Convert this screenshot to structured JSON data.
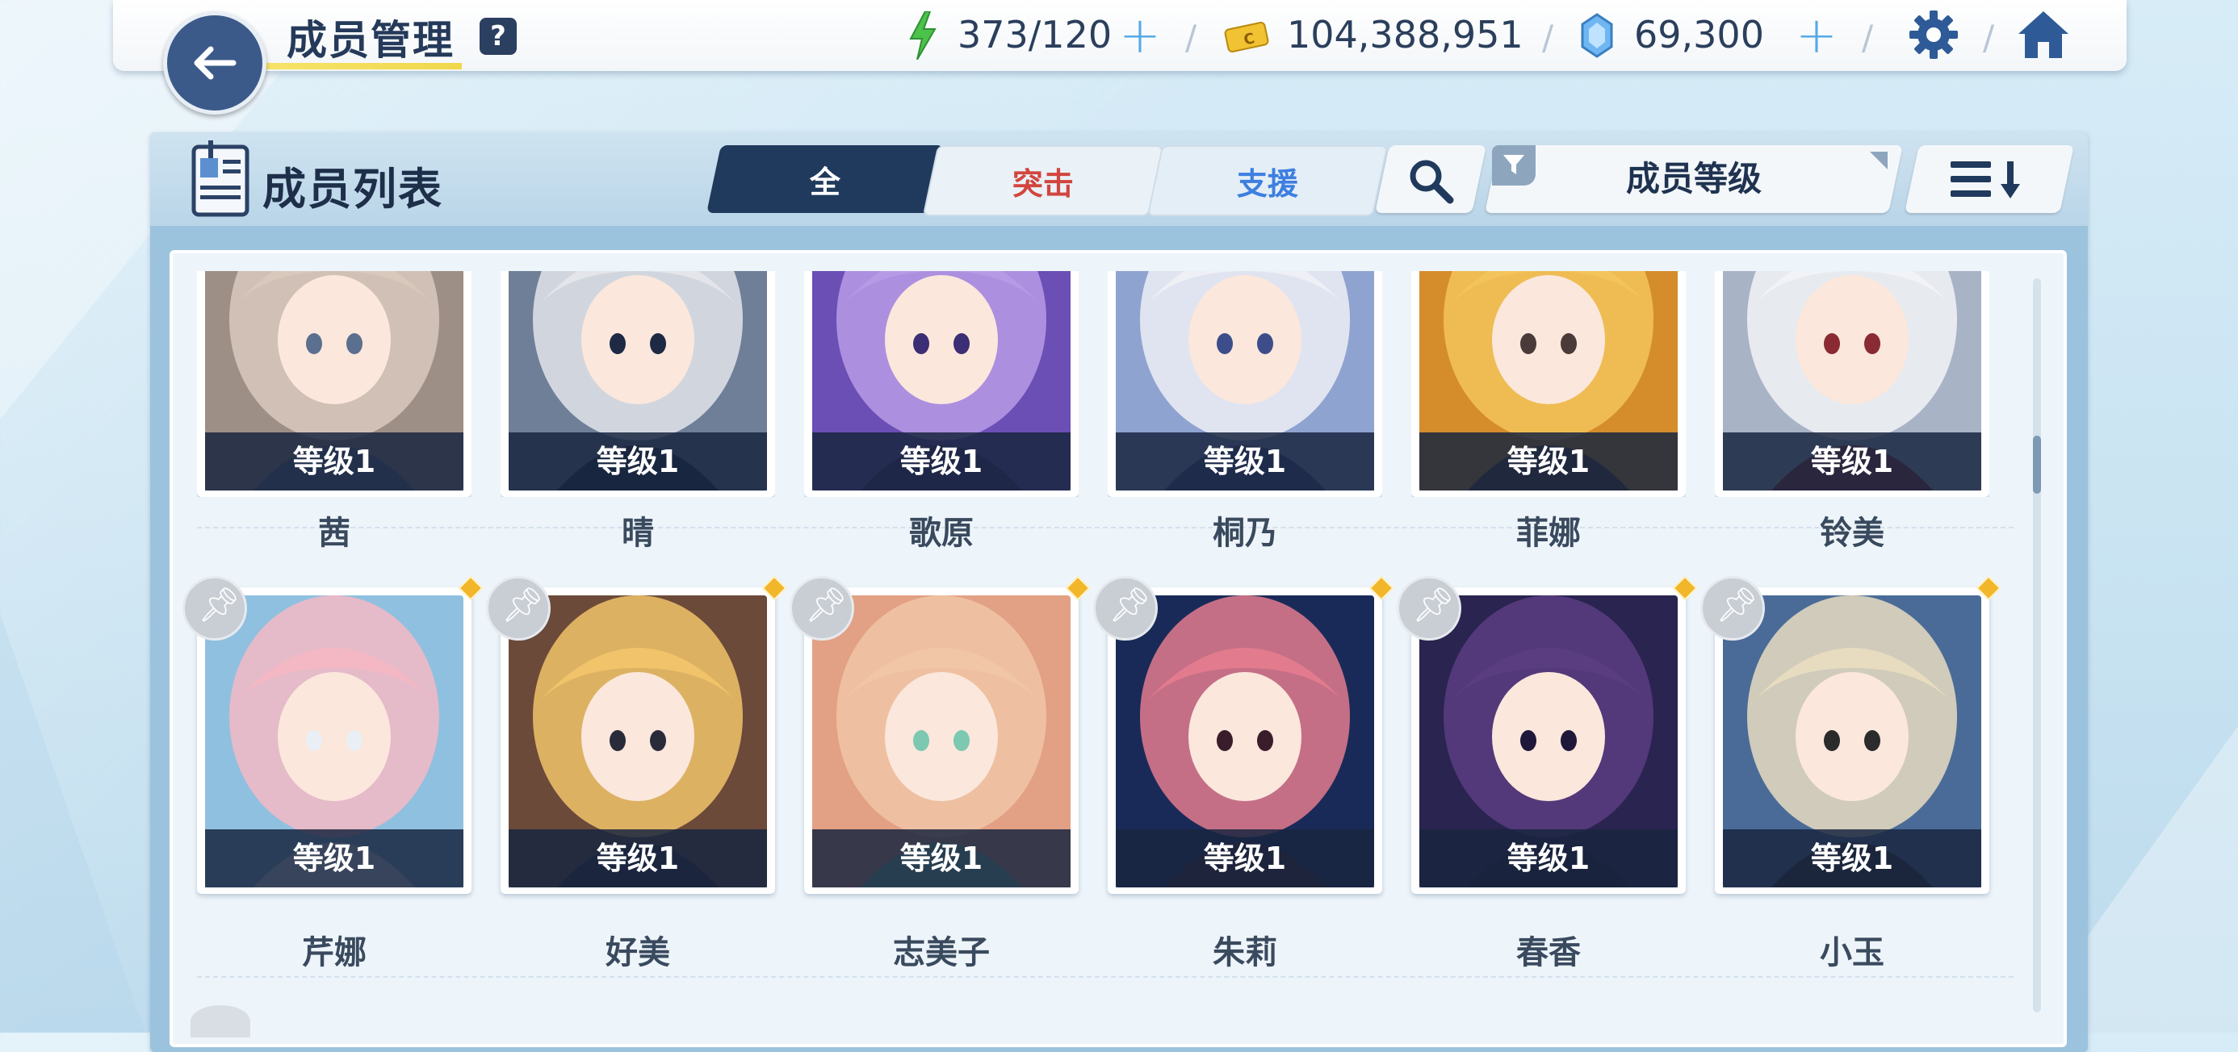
{
  "header": {
    "title": "成员管理",
    "help_label": "?",
    "energy": "373/120",
    "credits": "104,388,951",
    "gems": "69,300",
    "plus": "+"
  },
  "panel": {
    "title": "成员列表",
    "tabs": [
      {
        "label": "全",
        "active": true
      },
      {
        "label": "突击",
        "active": false
      },
      {
        "label": "支援",
        "active": false
      }
    ],
    "sort_label": "成员等级"
  },
  "members": [
    {
      "name": "茜",
      "level": "等级1"
    },
    {
      "name": "晴",
      "level": "等级1"
    },
    {
      "name": "歌原",
      "level": "等级1"
    },
    {
      "name": "桐乃",
      "level": "等级1"
    },
    {
      "name": "菲娜",
      "level": "等级1"
    },
    {
      "name": "铃美",
      "level": "等级1"
    },
    {
      "name": "芹娜",
      "level": "等级1"
    },
    {
      "name": "好美",
      "level": "等级1"
    },
    {
      "name": "志美子",
      "level": "等级1"
    },
    {
      "name": "朱莉",
      "level": "等级1"
    },
    {
      "name": "春香",
      "level": "等级1"
    },
    {
      "name": "小玉",
      "level": "等级1"
    }
  ],
  "colors": {
    "accent_dark": "#1f3a5c",
    "assault": "#d1453e",
    "support": "#3d7fe0",
    "energy_green": "#4bc24a",
    "gem_blue": "#6fb7f2",
    "credit_yellow": "#f1c232"
  }
}
